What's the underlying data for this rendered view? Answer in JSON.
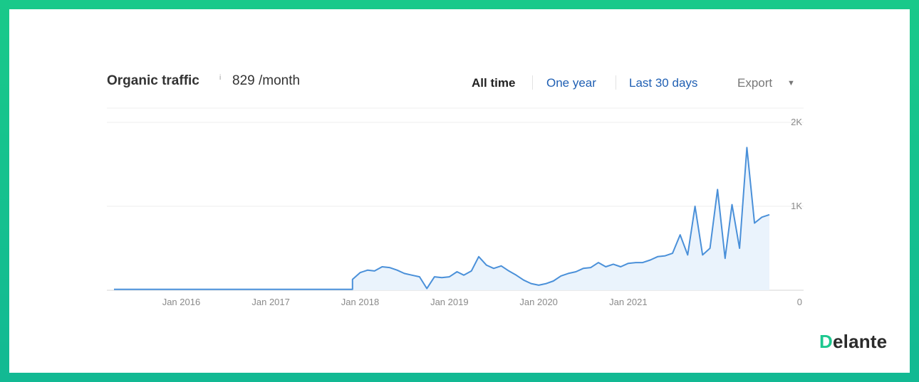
{
  "header": {
    "title": "Organic traffic",
    "info_icon": "i",
    "traffic_value": "829 /month",
    "ranges": {
      "all_time": "All time",
      "one_year": "One year",
      "last_30_days": "Last 30 days"
    },
    "export_label": "Export",
    "export_caret": "▼"
  },
  "brand": {
    "logo_first": "D",
    "logo_rest": "elante",
    "accent_color": "#1dc88f",
    "frame_color": "#15c08f"
  },
  "chart_data": {
    "type": "area",
    "x_tick_labels": [
      "Jan 2016",
      "Jan 2017",
      "Jan 2018",
      "Jan 2019",
      "Jan 2020",
      "Jan 2021"
    ],
    "y_tick_labels": [
      "2K",
      "1K",
      "0"
    ],
    "ylim": [
      0,
      2000
    ],
    "grid": "horizontal",
    "line_color": "#4a90d9",
    "fill_color": "#eaf3fc",
    "series": [
      {
        "x": [
          "2015-04",
          "2015-06",
          "2016-01",
          "2016-06",
          "2017-01",
          "2017-06",
          "2017-12",
          "2017-12",
          "2018-01",
          "2018-02",
          "2018-03",
          "2018-04",
          "2018-05",
          "2018-06",
          "2018-07",
          "2018-08",
          "2018-09",
          "2018-10",
          "2018-11",
          "2018-12",
          "2019-01",
          "2019-02",
          "2019-03",
          "2019-04",
          "2019-05",
          "2019-06",
          "2019-07",
          "2019-08",
          "2019-09",
          "2019-10",
          "2019-11",
          "2019-12",
          "2020-01",
          "2020-02",
          "2020-03",
          "2020-04",
          "2020-05",
          "2020-06",
          "2020-07",
          "2020-08",
          "2020-09",
          "2020-10",
          "2020-11",
          "2020-12",
          "2021-01",
          "2021-02",
          "2021-03",
          "2021-04",
          "2021-05",
          "2021-06",
          "2021-07",
          "2021-08",
          "2021-09",
          "2021-10",
          "2021-11",
          "2021-12",
          "2022-01",
          "2022-02",
          "2022-03",
          "2022-04",
          "2022-05",
          "2022-06",
          "2022-07",
          "2022-08"
        ],
        "y": [
          10,
          10,
          10,
          10,
          10,
          10,
          10,
          130,
          210,
          240,
          230,
          280,
          270,
          240,
          200,
          180,
          160,
          20,
          160,
          150,
          160,
          220,
          180,
          230,
          400,
          300,
          260,
          290,
          230,
          180,
          120,
          80,
          60,
          80,
          110,
          170,
          200,
          220,
          260,
          270,
          330,
          280,
          310,
          280,
          320,
          330,
          330,
          360,
          400,
          410,
          440,
          660,
          420,
          1000,
          420,
          500,
          1200,
          380,
          1020,
          500,
          1700,
          800,
          870,
          900
        ]
      }
    ]
  }
}
